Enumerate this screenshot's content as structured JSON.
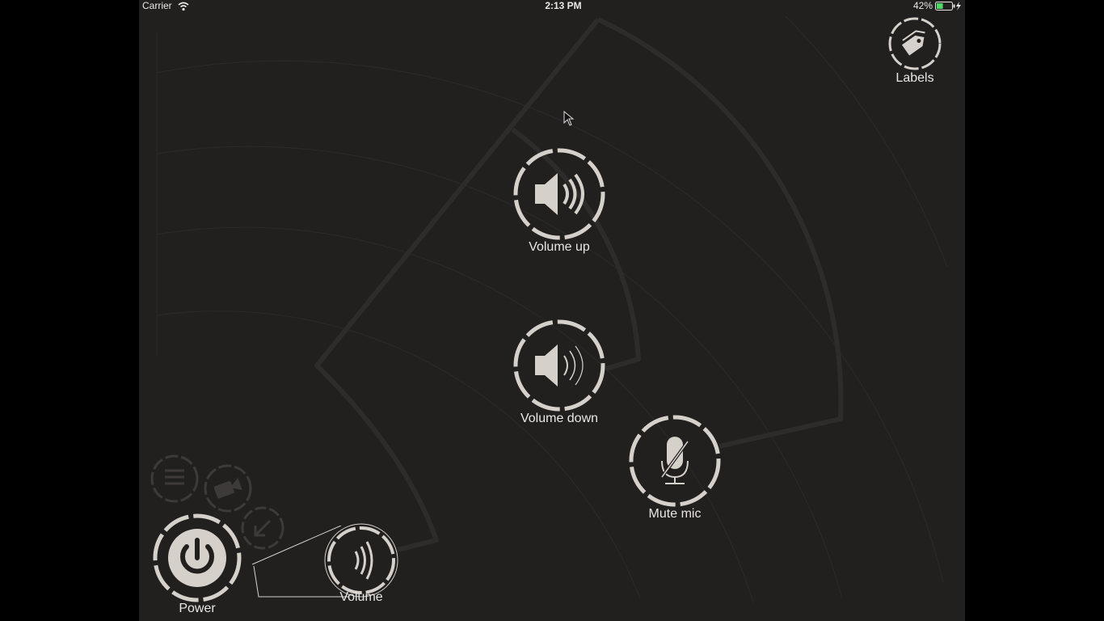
{
  "status_bar": {
    "carrier": "Carrier",
    "time": "2:13 PM",
    "battery_percent": "42%",
    "battery_level": 0.42,
    "icons": [
      "wifi-icon",
      "battery-icon",
      "charging-bolt-icon"
    ]
  },
  "top_right": {
    "labels_label": "Labels",
    "icon": "tag-icon"
  },
  "controls": {
    "volume_up": {
      "label": "Volume up",
      "icon": "speaker-loud-icon"
    },
    "volume_down": {
      "label": "Volume down",
      "icon": "speaker-soft-icon"
    },
    "mute_mic": {
      "label": "Mute mic",
      "icon": "microphone-muted-icon"
    }
  },
  "bottom_bar": {
    "power_label": "Power",
    "volume_label": "Volume",
    "icons": [
      "menu-icon",
      "video-camera-icon",
      "arrow-in-icon",
      "power-icon",
      "volume-waves-icon"
    ]
  },
  "colors": {
    "background": "#221f1f",
    "button": "#d6d0cb",
    "text": "#e9e6e3"
  }
}
